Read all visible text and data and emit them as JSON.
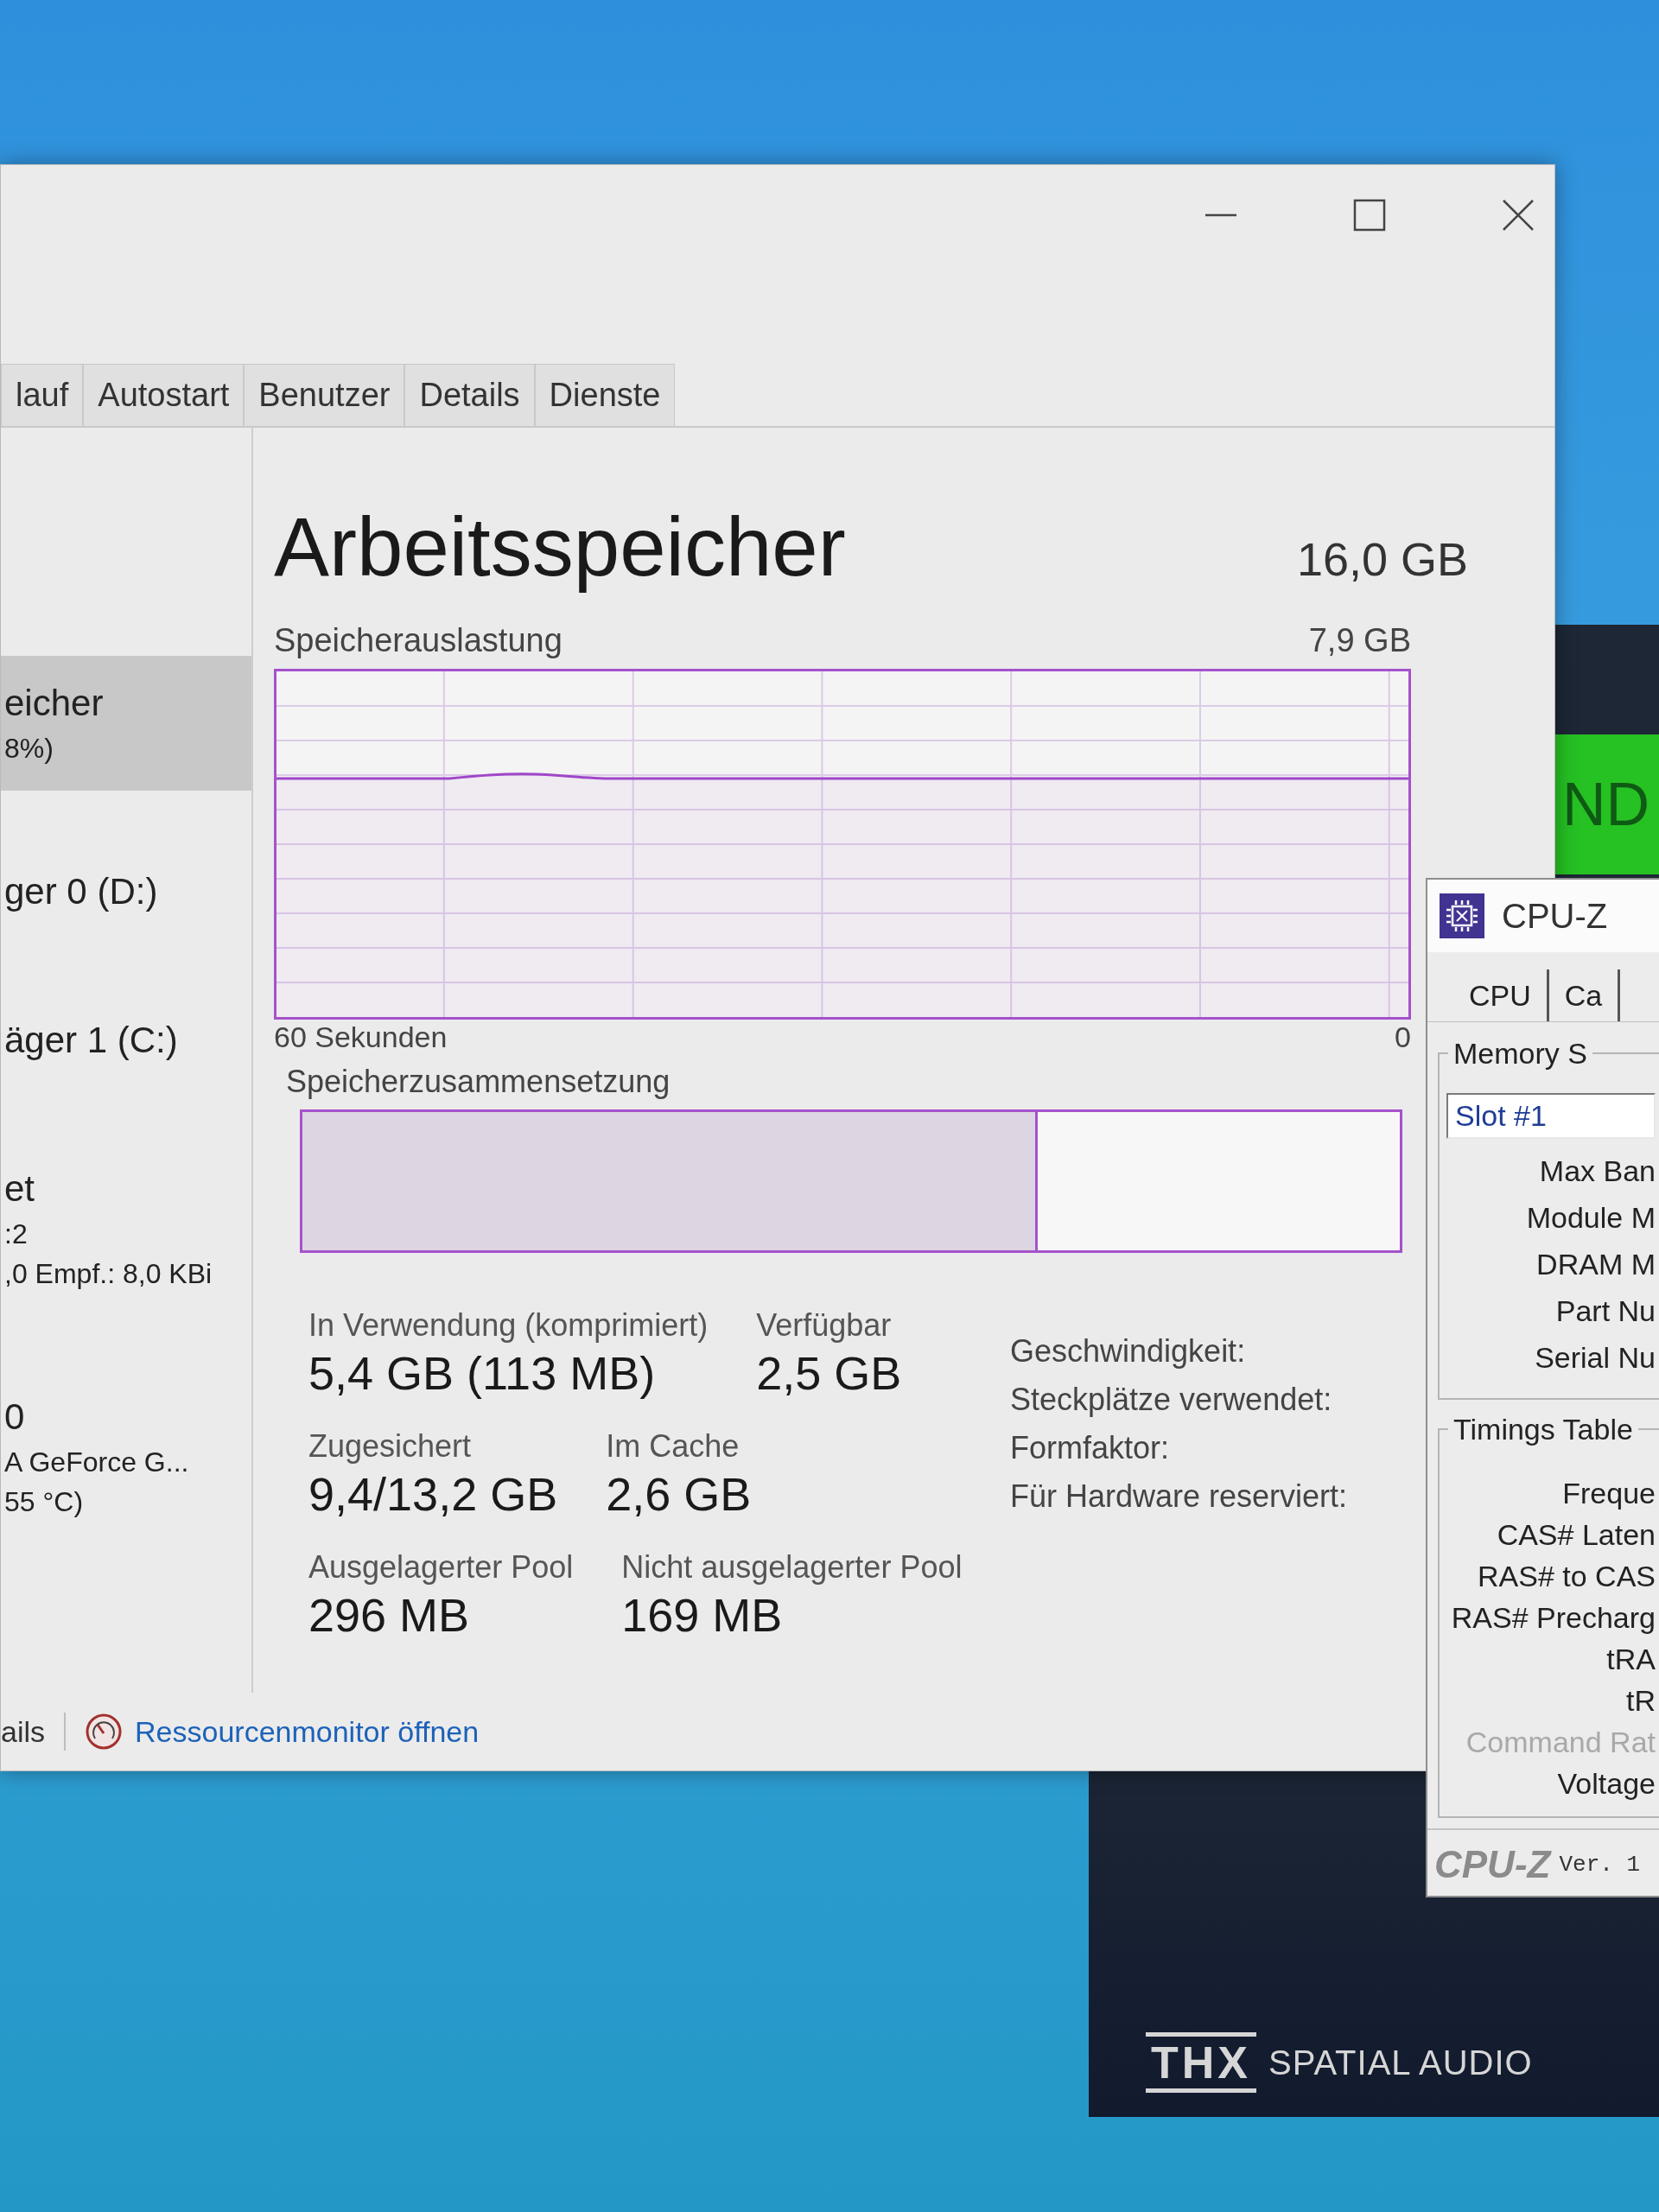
{
  "task_manager": {
    "tabs": [
      {
        "label": "lauf",
        "selected": false
      },
      {
        "label": "Autostart",
        "selected": false
      },
      {
        "label": "Benutzer",
        "selected": false
      },
      {
        "label": "Details",
        "selected": false
      },
      {
        "label": "Dienste",
        "selected": false
      }
    ],
    "sidebar": {
      "items": [
        {
          "lines": [
            "eicher",
            "8%)"
          ],
          "selected": true
        },
        {
          "lines": [
            "ger 0 (D:)"
          ],
          "selected": false
        },
        {
          "lines": [
            "äger 1 (C:)"
          ],
          "selected": false
        },
        {
          "lines": [
            "et",
            ":2",
            ",0 Empf.: 8,0 KBi"
          ],
          "selected": false
        },
        {
          "lines": [
            "0",
            "A GeForce G...",
            "55 °C)"
          ],
          "selected": false
        }
      ]
    },
    "memory": {
      "title": "Arbeitsspeicher",
      "total": "16,0 GB",
      "usage_graph": {
        "label": "Speicherauslastung",
        "max_label": "7,9 GB",
        "start_label": "60 Sekunden",
        "end_label": "0"
      },
      "composition": {
        "label": "Speicherzusammensetzung",
        "level": 0.67
      },
      "stat_rows": [
        [
          {
            "label": "In Verwendung (komprimiert)",
            "value": "5,4 GB (113 MB)"
          },
          {
            "label": "Verfügbar",
            "value": "2,5 GB"
          }
        ],
        [
          {
            "label": "Zugesichert",
            "value": "9,4/13,2 GB"
          },
          {
            "label": "Im Cache",
            "value": "2,6 GB"
          }
        ],
        [
          {
            "label": "Ausgelagerter Pool",
            "value": "296 MB"
          },
          {
            "label": "Nicht ausgelagerter Pool",
            "value": "169 MB"
          }
        ]
      ],
      "hardware_labels": [
        "Geschwindigkeit:",
        "Steckplätze verwendet:",
        "Formfaktor:",
        "Für Hardware reserviert:"
      ]
    },
    "footer": {
      "details_toggle": "ails",
      "resource_monitor_link": "Ressourcenmonitor öffnen"
    }
  },
  "background_app": {
    "banner": "ND",
    "logo_wordmark": "THX",
    "logo_tagline": "SPATIAL AUDIO"
  },
  "cpu_z": {
    "title": "CPU-Z",
    "tabs": [
      {
        "label": "CPU",
        "selected": false
      },
      {
        "label": "Ca",
        "selected": false
      }
    ],
    "memory_group": {
      "title": "Memory S",
      "slot": "Slot #1",
      "labels": [
        "Max Ban",
        "Module M",
        "DRAM M",
        "Part Nu",
        "Serial Nu"
      ]
    },
    "timings_group": {
      "title": "Timings Table",
      "labels": [
        {
          "text": "Freque",
          "disabled": false
        },
        {
          "text": "CAS# Laten",
          "disabled": false
        },
        {
          "text": "RAS# to CAS",
          "disabled": false
        },
        {
          "text": "RAS# Precharg",
          "disabled": false
        },
        {
          "text": "tRA",
          "disabled": false
        },
        {
          "text": "tR",
          "disabled": false
        },
        {
          "text": "Command Rat",
          "disabled": true
        },
        {
          "text": "Voltage",
          "disabled": false
        }
      ]
    },
    "footer": {
      "logo": "CPU-Z",
      "version": "Ver. 1"
    }
  }
}
